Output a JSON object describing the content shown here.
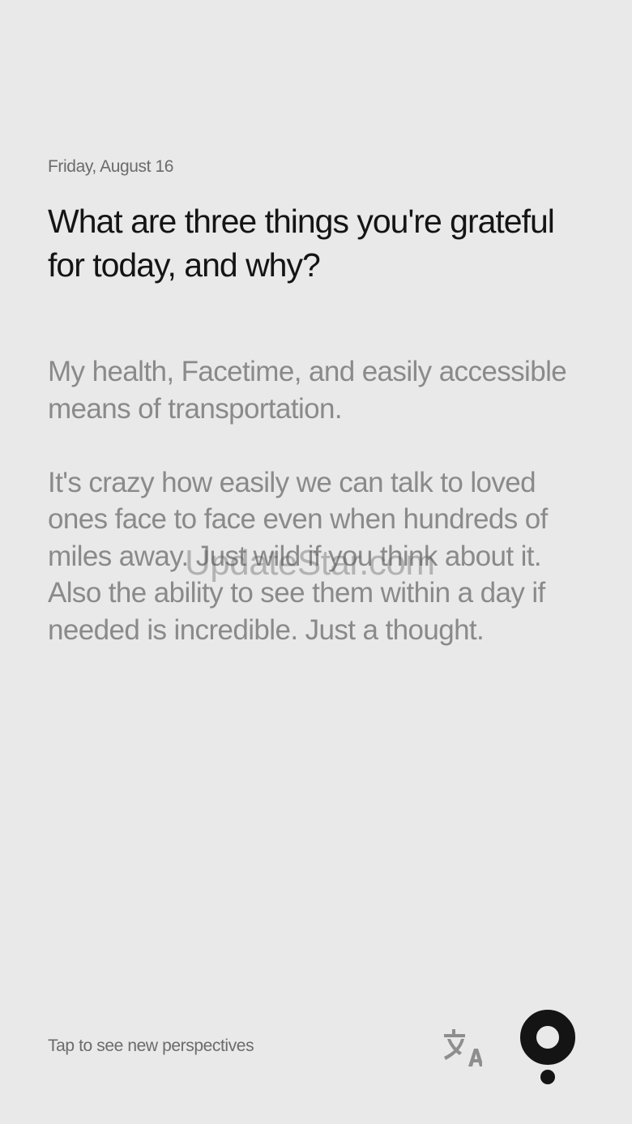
{
  "entry": {
    "date": "Friday, August 16",
    "question": "What are three things you're grateful for today, and why?",
    "answer": "My health, Facetime, and easily accessible means of transportation.\n\nIt's crazy how easily we can talk to loved ones face to face even when hundreds of miles away. Just wild if you think about it. Also the ability to see them within a day if needed is incredible. Just a thought."
  },
  "watermark": "UpdateStar.com",
  "footer": {
    "hint": "Tap to see new perspectives",
    "translate_icon": "translate-icon",
    "logo_icon": "app-logo-icon"
  },
  "colors": {
    "background": "#e9e9e9",
    "question_text": "#141414",
    "answer_text": "#8a8a8a",
    "meta_text": "#6b6b6b",
    "icon_dark": "#141414",
    "icon_gray": "#8e8e8e"
  }
}
